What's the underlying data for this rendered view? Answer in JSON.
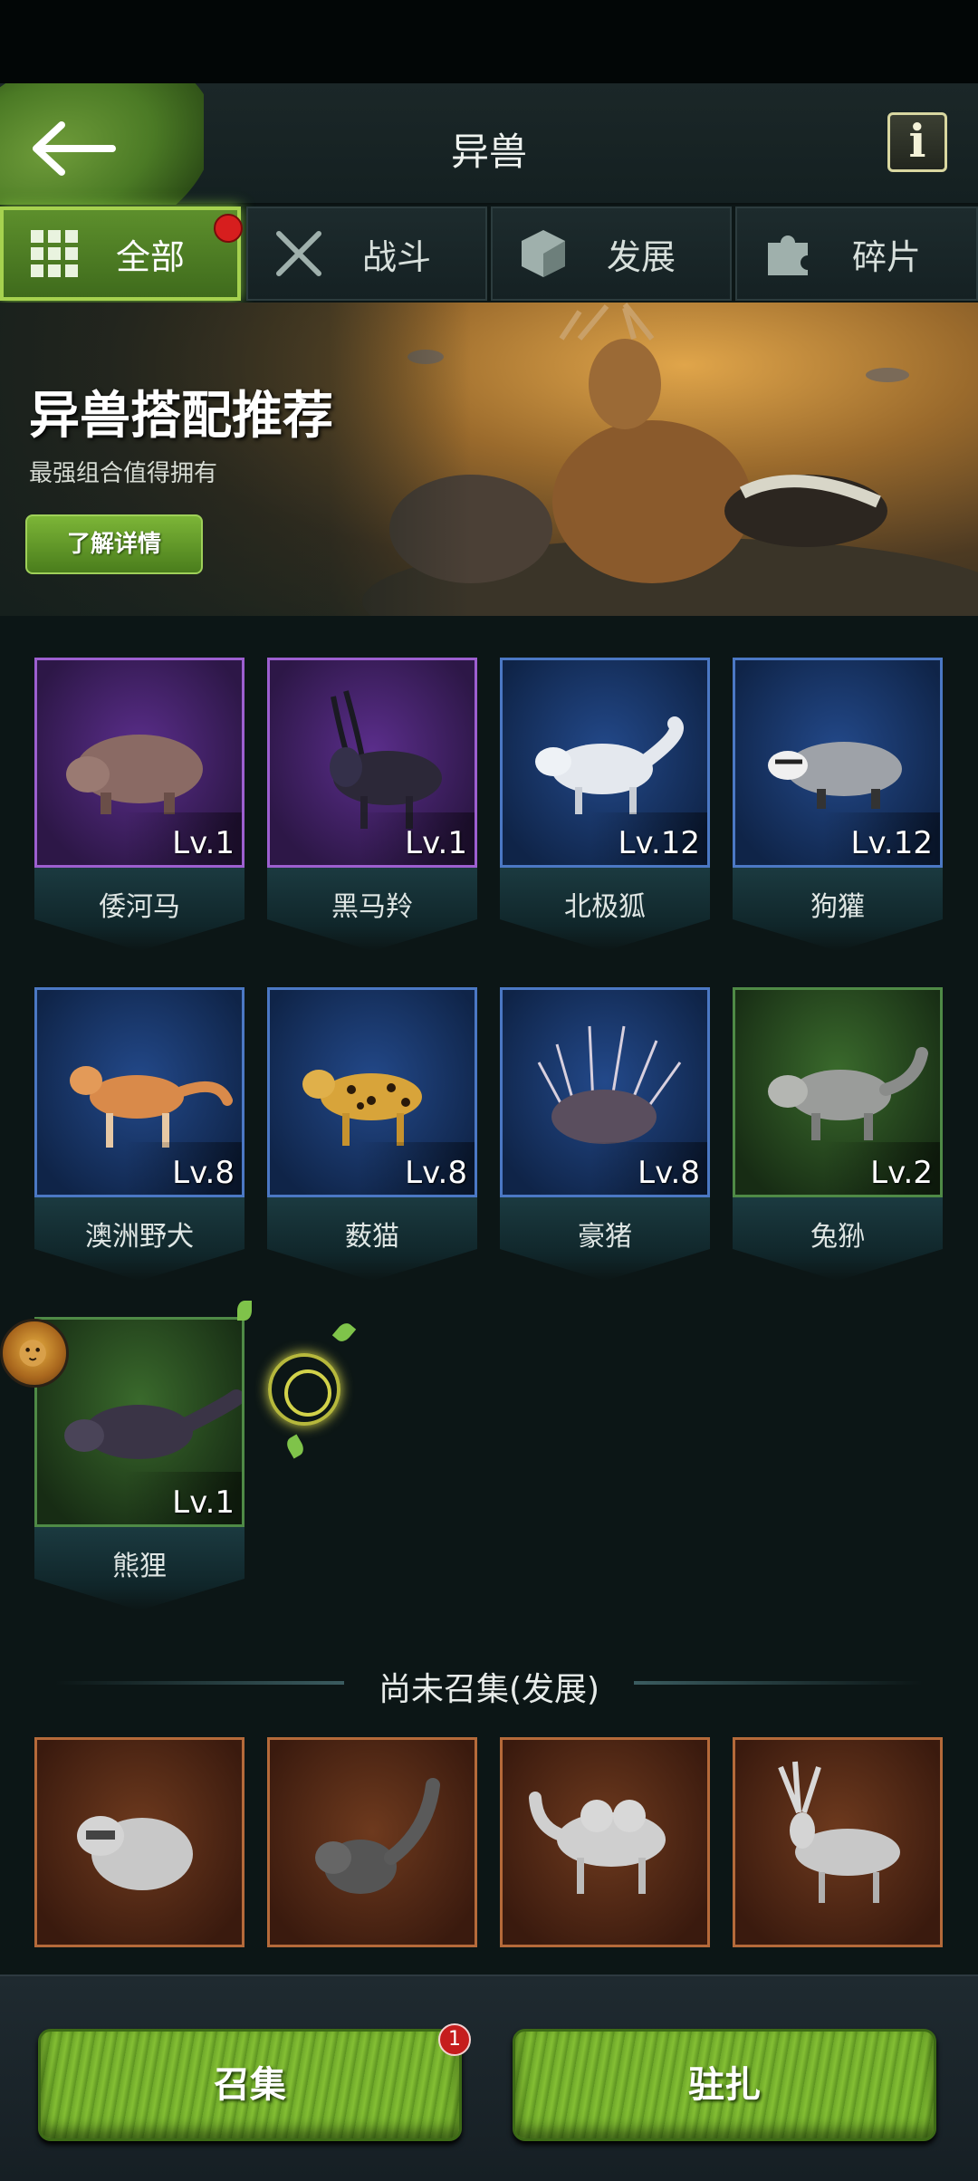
{
  "header": {
    "title": "异兽",
    "info_label": "i"
  },
  "tabs": [
    {
      "label": "全部",
      "active": true,
      "icon": "grid-icon",
      "has_dot": true
    },
    {
      "label": "战斗",
      "active": false,
      "icon": "crossed-swords-icon"
    },
    {
      "label": "发展",
      "active": false,
      "icon": "cube-icon"
    },
    {
      "label": "碎片",
      "active": false,
      "icon": "puzzle-icon"
    }
  ],
  "banner": {
    "title": "异兽搭配推荐",
    "subtitle": "最强组合值得拥有",
    "button": "了解详情"
  },
  "owned": [
    {
      "name": "倭河马",
      "level": "Lv.1",
      "rarity": "purple"
    },
    {
      "name": "黑马羚",
      "level": "Lv.1",
      "rarity": "purple"
    },
    {
      "name": "北极狐",
      "level": "Lv.12",
      "rarity": "blue"
    },
    {
      "name": "狗獾",
      "level": "Lv.12",
      "rarity": "blue"
    },
    {
      "name": "澳洲野犬",
      "level": "Lv.8",
      "rarity": "blue"
    },
    {
      "name": "薮猫",
      "level": "Lv.8",
      "rarity": "blue"
    },
    {
      "name": "豪猪",
      "level": "Lv.8",
      "rarity": "blue"
    },
    {
      "name": "兔狲",
      "level": "Lv.2",
      "rarity": "green"
    },
    {
      "name": "熊狸",
      "level": "Lv.1",
      "rarity": "green"
    }
  ],
  "unsummoned_section": {
    "title": "尚未召集(发展)"
  },
  "bottom": {
    "summon_label": "召集",
    "summon_badge": "1",
    "station_label": "驻扎"
  },
  "colors": {
    "purple_frame": "#9d5fd0",
    "blue_frame": "#4b78c4",
    "green_frame": "#4f8a46",
    "orange_frame": "#b56a3a",
    "accent_green": "#7bb83a"
  }
}
